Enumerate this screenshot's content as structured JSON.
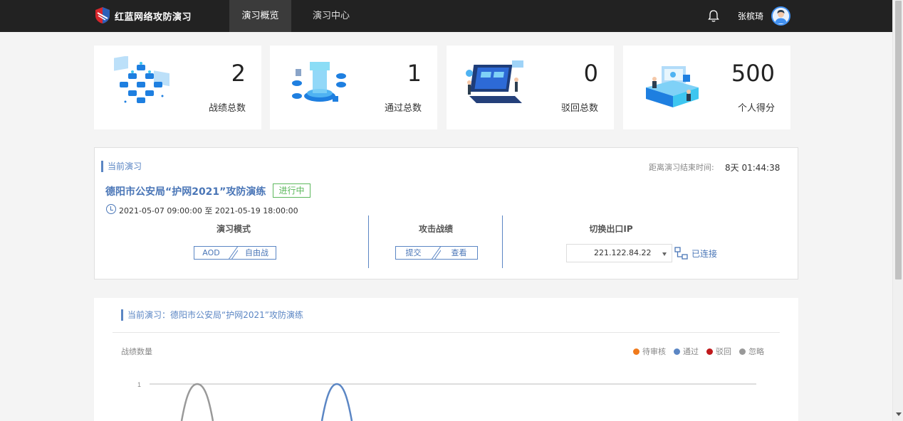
{
  "header": {
    "brand": "红蓝网络攻防演习",
    "tabs": [
      "演习概览",
      "演习中心"
    ],
    "active_tab": "演习概览",
    "username": "张槟琦"
  },
  "stats": [
    {
      "value": "2",
      "label": "战绩总数"
    },
    {
      "value": "1",
      "label": "通过总数"
    },
    {
      "value": "0",
      "label": "驳回总数"
    },
    {
      "value": "500",
      "label": "个人得分"
    }
  ],
  "current_drill": {
    "section_title": "当前演习",
    "countdown_label": "距离演习结束时间:",
    "countdown_value": "8天 01:44:38",
    "name": "德阳市公安局“护网2021”攻防演练",
    "status": "进行中",
    "time_range": "2021-05-07 09:00:00 至 2021-05-19 18:00:00",
    "columns": {
      "mode": {
        "title": "演习模式",
        "options": [
          "AOD",
          "自由战"
        ]
      },
      "attack": {
        "title": "攻击战绩",
        "options": [
          "提交",
          "查看"
        ]
      },
      "ip": {
        "title": "切换出口IP",
        "selected": "221.122.84.22",
        "status": "已连接"
      }
    }
  },
  "chart_panel": {
    "title": "当前演习：德阳市公安局“护网2021”攻防演练"
  },
  "chart_data": {
    "type": "line",
    "ylabel": "战绩数量",
    "yticks": [
      "1"
    ],
    "legend_position": "top-right",
    "series": [
      {
        "name": "待审核",
        "color": "#f07a1c"
      },
      {
        "name": "通过",
        "color": "#5b86c4",
        "peak": 1
      },
      {
        "name": "驳回",
        "color": "#c0191c"
      },
      {
        "name": "忽略",
        "color": "#999999",
        "peak": 1
      }
    ]
  }
}
